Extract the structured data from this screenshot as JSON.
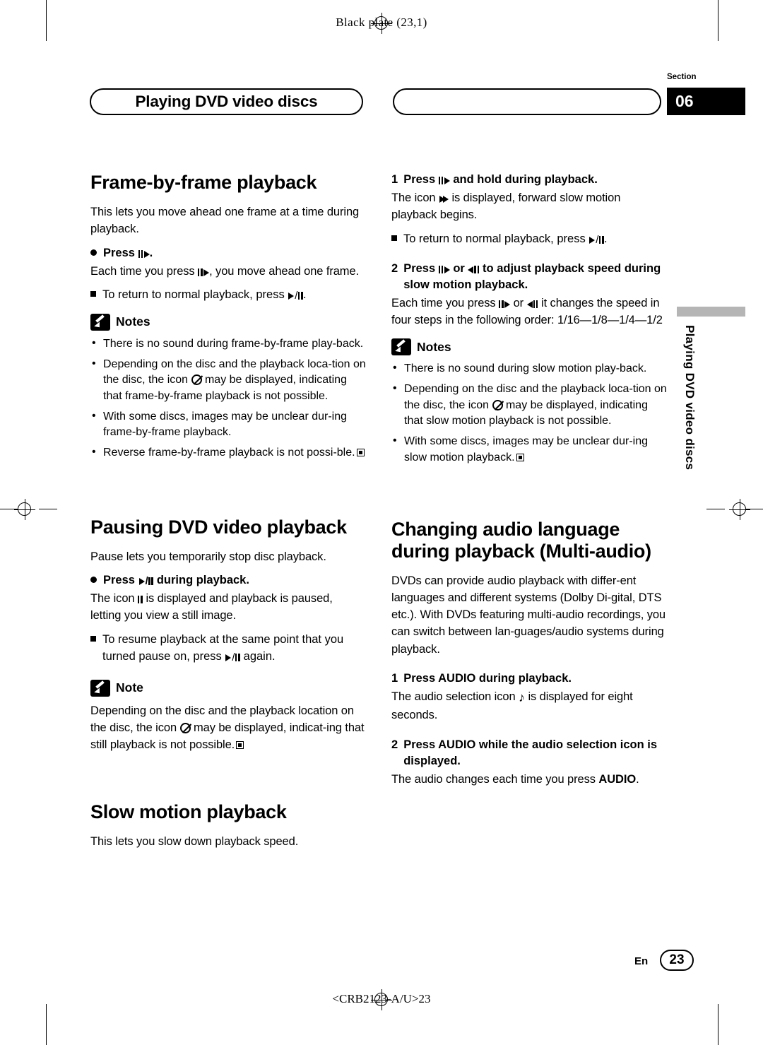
{
  "page": {
    "black_plate": "Black plate (23,1)",
    "footer_code": "<CRB2123-A/U>23",
    "page_lang": "En",
    "page_number": "23",
    "section_label": "Section",
    "section_number": "06",
    "header_title": "Playing DVD video discs",
    "side_tab": "Playing DVD video discs"
  },
  "left_column": {
    "frame_by_frame": {
      "heading": "Frame-by-frame playback",
      "intro": "This lets you move ahead one frame at a time during playback.",
      "step_label": "Press",
      "step_suffix": ".",
      "step_body": ", you move ahead one frame.",
      "step_body_prefix": "Each time you press",
      "sub_note_prefix": "To return to normal playback, press",
      "sub_note_suffix": ".",
      "notes_label": "Notes",
      "notes": [
        "There is no sound during frame-by-frame play-back.",
        "Depending on the disc and the playback loca-tion on the disc, the icon ~ may be displayed, indicating that frame-by-frame playback is not possible.",
        "With some discs, images may be unclear dur-ing frame-by-frame playback.",
        "Reverse frame-by-frame playback is not possi-ble."
      ]
    },
    "pausing": {
      "heading": "Pausing DVD video playback",
      "intro": "Pause lets you temporarily stop disc playback.",
      "step_label": "Press",
      "step_suffix": "during playback.",
      "body": "The icon ❚❚ is displayed and playback is paused, letting you view a still image.",
      "sub_note": "To resume playback at the same point that you turned pause on, press",
      "sub_note_suffix": "again.",
      "note_label": "Note",
      "note_text_1": "Depending on the disc and the playback location on the disc, the icon",
      "note_text_2": "may be displayed, indicat-ing that still playback is not possible."
    },
    "slow_motion": {
      "heading": "Slow motion playback",
      "intro": "This lets you slow down playback speed."
    }
  },
  "right_column": {
    "slow_motion_steps": {
      "step1_num": "1",
      "step1_label": "Press",
      "step1_suffix": "and hold during playback.",
      "step1_body_prefix": "The icon",
      "step1_body_suffix": "is displayed, forward slow motion playback begins.",
      "step1_note_prefix": "To return to normal playback, press",
      "step1_note_suffix": ".",
      "step2_num": "2",
      "step2_label_a": "Press",
      "step2_label_b": "or",
      "step2_label_c": "to adjust playback speed during slow motion playback.",
      "step2_body_prefix": "Each time you press",
      "step2_body_mid": "or",
      "step2_body_suffix": "it changes the speed in four steps in the following order:",
      "step2_body_order": "1/16—1/8—1/4—1/2",
      "notes_label": "Notes",
      "notes": [
        "There is no sound during slow motion play-back.",
        "Depending on the disc and the playback loca-tion on the disc, the icon ~ may be displayed, indicating that slow motion playback is not possible.",
        "With some discs, images may be unclear dur-ing slow motion playback."
      ]
    },
    "audio_language": {
      "heading_line1": "Changing audio language",
      "heading_line2": "during playback (Multi-audio)",
      "intro": "DVDs can provide audio playback with differ-ent languages and different systems (Dolby Di-gital, DTS etc.). With DVDs featuring multi-audio recordings, you can switch between lan-guages/audio systems during playback.",
      "step1_num": "1",
      "step1_label": "Press AUDIO during playback.",
      "step1_body_prefix": "The audio selection icon",
      "step1_body_suffix": "is displayed for eight seconds.",
      "step2_num": "2",
      "step2_label_line1": "Press AUDIO while the audio selection",
      "step2_label_line2": "icon is displayed.",
      "step2_body": "The audio changes each time you press",
      "step2_body_bold": "AUDIO",
      "step2_body_end": "."
    }
  }
}
